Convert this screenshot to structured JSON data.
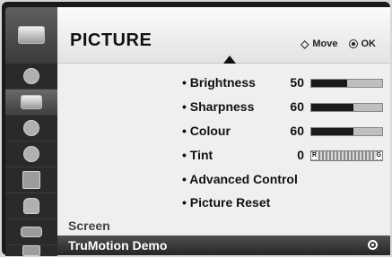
{
  "header": {
    "title": "PICTURE",
    "move_label": "Move",
    "ok_label": "OK",
    "move_icon": "four-way-arrow-icon",
    "ok_icon": "ok-button-icon"
  },
  "sidebar": {
    "items": [
      {
        "name": "tv-icon"
      },
      {
        "name": "satellite-dish-icon"
      },
      {
        "name": "picture-icon"
      },
      {
        "name": "audio-icon"
      },
      {
        "name": "clock-icon"
      },
      {
        "name": "calendar-icon"
      },
      {
        "name": "lock-icon"
      },
      {
        "name": "input-plug-icon"
      },
      {
        "name": "usb-photo-icon"
      }
    ]
  },
  "settings": [
    {
      "label": "• Brightness",
      "value": "50",
      "level": 0.5,
      "type": "bar"
    },
    {
      "label": "• Sharpness",
      "value": "60",
      "level": 0.6,
      "type": "bar"
    },
    {
      "label": "• Colour",
      "value": "60",
      "level": 0.6,
      "type": "bar"
    },
    {
      "label": "• Tint",
      "value": "0",
      "type": "tint",
      "left_mark": "R",
      "right_mark": "G"
    },
    {
      "label": "• Advanced Control"
    },
    {
      "label": "• Picture Reset"
    }
  ],
  "section": {
    "label": "Screen"
  },
  "selected": {
    "label": "TruMotion Demo"
  },
  "colors": {
    "frame": "#1a1a1a",
    "selected_bg": "#3a3a3a",
    "panel": "#f5f5f5"
  }
}
